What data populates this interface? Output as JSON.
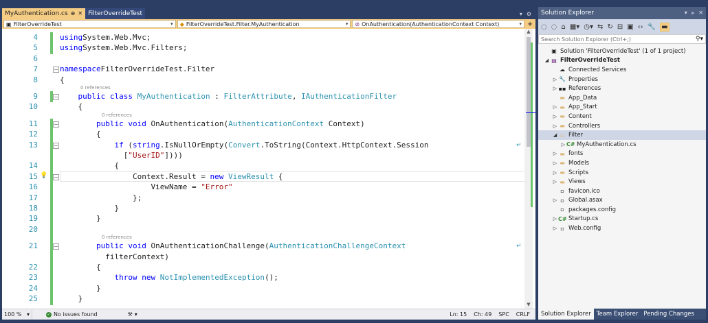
{
  "editor": {
    "tabs": [
      {
        "label": "MyAuthentication.cs",
        "active": true,
        "pin": "⊕",
        "close": "✕"
      },
      {
        "label": "FilterOverrideTest",
        "active": false
      }
    ],
    "tab_strip_icons": [
      "▾",
      "⚙"
    ],
    "nav": {
      "project": "FilterOverrideTest",
      "class": "FilterOverrideTest.Filter.MyAuthentication",
      "member": "OnAuthentication(AuthenticationContext Context)",
      "split_icon": "+"
    },
    "lines": [
      {
        "n": "4",
        "segs": [
          [
            "kw",
            "using"
          ],
          [
            "",
            "System.Web.Mvc;"
          ]
        ]
      },
      {
        "n": "5",
        "segs": [
          [
            "kw",
            "using"
          ],
          [
            "",
            "System.Web.Mvc.Filters;"
          ]
        ]
      },
      {
        "n": "6",
        "segs": []
      },
      {
        "n": "7",
        "segs": [
          [
            "kw",
            "namespace"
          ],
          [
            "",
            "FilterOverrideTest.Filter"
          ]
        ]
      },
      {
        "n": "8",
        "segs": [
          [
            "",
            "{"
          ]
        ]
      },
      {
        "n": "9",
        "segs": [
          [
            "",
            "    "
          ],
          [
            "kw",
            "public"
          ],
          [
            "",
            ""
          ],
          [
            "kw",
            "class"
          ],
          [
            "",
            ""
          ],
          [
            "ty",
            "MyAuthentication"
          ],
          [
            "",
            " : "
          ],
          [
            "ty",
            "FilterAttribute"
          ],
          [
            "",
            ", "
          ],
          [
            "ty",
            "IAuthenticationFilter"
          ]
        ]
      },
      {
        "n": "10",
        "segs": [
          [
            "",
            "    {"
          ]
        ]
      },
      {
        "n": "11",
        "segs": [
          [
            "",
            "        "
          ],
          [
            "kw",
            "public"
          ],
          [
            "",
            ""
          ],
          [
            "kw",
            "void"
          ],
          [
            "",
            " OnAuthentication("
          ],
          [
            "ty",
            "AuthenticationContext"
          ],
          [
            "",
            " Context)"
          ]
        ]
      },
      {
        "n": "12",
        "segs": [
          [
            "",
            "        {"
          ]
        ]
      },
      {
        "n": "13",
        "segs": [
          [
            "",
            "            "
          ],
          [
            "kw",
            "if"
          ],
          [
            "",
            " ("
          ],
          [
            "kw",
            "string"
          ],
          [
            "",
            ".IsNullOrEmpty("
          ],
          [
            "ty",
            "Convert"
          ],
          [
            "",
            ".ToString(Context.HttpContext.Session"
          ]
        ]
      },
      {
        "n": "",
        "segs": [
          [
            "",
            "              ["
          ],
          [
            "st",
            "\"UserID\""
          ],
          [
            "",
            "])))"
          ]
        ]
      },
      {
        "n": "14",
        "segs": [
          [
            "",
            "            {"
          ]
        ]
      },
      {
        "n": "15",
        "segs": [
          [
            "",
            "                Context.Result = "
          ],
          [
            "kw",
            "new"
          ],
          [
            "",
            ""
          ],
          [
            "ty",
            "ViewResult"
          ],
          [
            "",
            " {"
          ]
        ]
      },
      {
        "n": "16",
        "segs": [
          [
            "",
            "                    ViewName = "
          ],
          [
            "st",
            "\"Error\""
          ]
        ]
      },
      {
        "n": "17",
        "segs": [
          [
            "",
            "                };"
          ]
        ]
      },
      {
        "n": "18",
        "segs": [
          [
            "",
            "            }"
          ]
        ]
      },
      {
        "n": "19",
        "segs": [
          [
            "",
            "        }"
          ]
        ]
      },
      {
        "n": "20",
        "segs": []
      },
      {
        "n": "21",
        "segs": [
          [
            "",
            "        "
          ],
          [
            "kw",
            "public"
          ],
          [
            "",
            ""
          ],
          [
            "kw",
            "void"
          ],
          [
            "",
            " OnAuthenticationChallenge("
          ],
          [
            "ty",
            "AuthenticationChallengeContext"
          ]
        ]
      },
      {
        "n": "",
        "segs": [
          [
            "",
            "          filterContext)"
          ]
        ]
      },
      {
        "n": "22",
        "segs": [
          [
            "",
            "        {"
          ]
        ]
      },
      {
        "n": "23",
        "segs": [
          [
            "",
            "            "
          ],
          [
            "kw",
            "throw"
          ],
          [
            "",
            ""
          ],
          [
            "kw",
            "new"
          ],
          [
            "",
            ""
          ],
          [
            "ty",
            "NotImplementedException"
          ],
          [
            "",
            "();"
          ]
        ]
      },
      {
        "n": "24",
        "segs": [
          [
            "",
            "        }"
          ]
        ]
      },
      {
        "n": "25",
        "segs": [
          [
            "",
            "    }"
          ]
        ]
      }
    ],
    "codelens": [
      "0 references",
      "0 references",
      "0 references"
    ],
    "status": {
      "zoom": "100 %",
      "issues": "No issues found",
      "ln": "Ln: 15",
      "ch": "Ch: 49",
      "spc": "SPC",
      "crlf": "CRLF"
    }
  },
  "solution_explorer": {
    "title": "Solution Explorer",
    "title_icons": [
      "▾",
      "⫸",
      "✕"
    ],
    "search_placeholder": "Search Solution Explorer (Ctrl+;)",
    "tree": [
      {
        "label": "Solution 'FilterOverrideTest' (1 of 1 project)",
        "depth": 0,
        "exp": "",
        "icon": "▣",
        "icon_class": ""
      },
      {
        "label": "FilterOverrideTest",
        "depth": 0,
        "exp": "◢",
        "icon": "▤",
        "icon_class": "proj-ico",
        "bold": true
      },
      {
        "label": "Connected Services",
        "depth": 1,
        "exp": "",
        "icon": "☁",
        "icon_class": ""
      },
      {
        "label": "Properties",
        "depth": 1,
        "exp": "▷",
        "icon": "🔧",
        "icon_class": ""
      },
      {
        "label": "References",
        "depth": 1,
        "exp": "▷",
        "icon": "▪▪",
        "icon_class": ""
      },
      {
        "label": "App_Data",
        "depth": 1,
        "exp": "",
        "icon": "▬",
        "icon_class": "folder"
      },
      {
        "label": "App_Start",
        "depth": 1,
        "exp": "▷",
        "icon": "▬",
        "icon_class": "folder"
      },
      {
        "label": "Content",
        "depth": 1,
        "exp": "▷",
        "icon": "▬",
        "icon_class": "folder"
      },
      {
        "label": "Controllers",
        "depth": 1,
        "exp": "▷",
        "icon": "▬",
        "icon_class": "folder"
      },
      {
        "label": "Filter",
        "depth": 1,
        "exp": "◢",
        "icon": "▭",
        "icon_class": "folder",
        "selected": true
      },
      {
        "label": "MyAuthentication.cs",
        "depth": 2,
        "exp": "▷",
        "icon": "C#",
        "icon_class": "cs-ico"
      },
      {
        "label": "fonts",
        "depth": 1,
        "exp": "▷",
        "icon": "▬",
        "icon_class": "folder"
      },
      {
        "label": "Models",
        "depth": 1,
        "exp": "▷",
        "icon": "▬",
        "icon_class": "folder"
      },
      {
        "label": "Scripts",
        "depth": 1,
        "exp": "▷",
        "icon": "▬",
        "icon_class": "folder"
      },
      {
        "label": "Views",
        "depth": 1,
        "exp": "▷",
        "icon": "▬",
        "icon_class": "folder"
      },
      {
        "label": "favicon.ico",
        "depth": 1,
        "exp": "",
        "icon": "▫",
        "icon_class": ""
      },
      {
        "label": "Global.asax",
        "depth": 1,
        "exp": "▷",
        "icon": "▫",
        "icon_class": ""
      },
      {
        "label": "packages.config",
        "depth": 1,
        "exp": "",
        "icon": "▫",
        "icon_class": ""
      },
      {
        "label": "Startup.cs",
        "depth": 1,
        "exp": "▷",
        "icon": "C#",
        "icon_class": "cs-ico"
      },
      {
        "label": "Web.config",
        "depth": 1,
        "exp": "▷",
        "icon": "▫",
        "icon_class": ""
      }
    ],
    "tabs": [
      {
        "label": "Solution Explorer",
        "active": true
      },
      {
        "label": "Team Explorer",
        "active": false
      },
      {
        "label": "Pending Changes",
        "active": false
      }
    ]
  }
}
